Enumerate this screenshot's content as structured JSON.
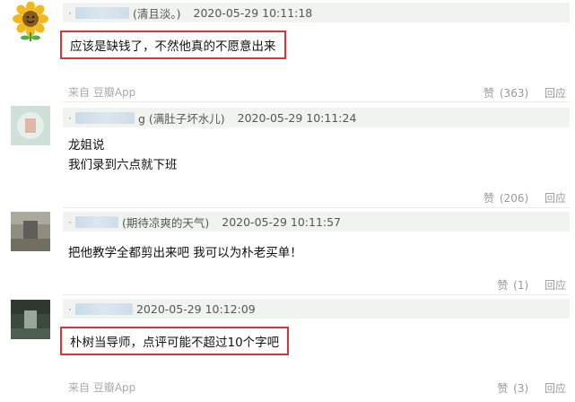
{
  "comments": [
    {
      "nick": "(清且淡。)",
      "time": "2020-05-29 10:11:18",
      "text": "应该是缺钱了，不然他真的不愿意出来",
      "source": "来自 豆瓣App",
      "like_label": "赞",
      "like_count": "(363)",
      "reply_label": "回应"
    },
    {
      "nick": "g (满肚子坏水儿)",
      "time": "2020-05-29 10:11:24",
      "lines": [
        "龙姐说",
        "我们录到六点就下班"
      ],
      "like_label": "赞",
      "like_count": "(206)",
      "reply_label": "回应"
    },
    {
      "nick": "(期待凉爽的天气)",
      "time": "2020-05-29 10:11:57",
      "text": "把他教学全都剪出来吧 我可以为朴老买单！",
      "like_label": "赞",
      "like_count": "(1)",
      "reply_label": "回应"
    },
    {
      "nick": "",
      "time": "2020-05-29 10:12:09",
      "text": "朴树当导师，点评可能不超过10个字吧",
      "source": "来自 豆瓣App",
      "like_label": "赞",
      "like_count": "(3)",
      "reply_label": "回应"
    }
  ],
  "colors": {
    "highlight_border": "#d6353a",
    "meta_bg": "#f0f3f0",
    "muted": "#999999"
  },
  "icons": [
    "sunflower-avatar",
    "blurred-avatar",
    "blurred-avatar",
    "blurred-avatar"
  ]
}
